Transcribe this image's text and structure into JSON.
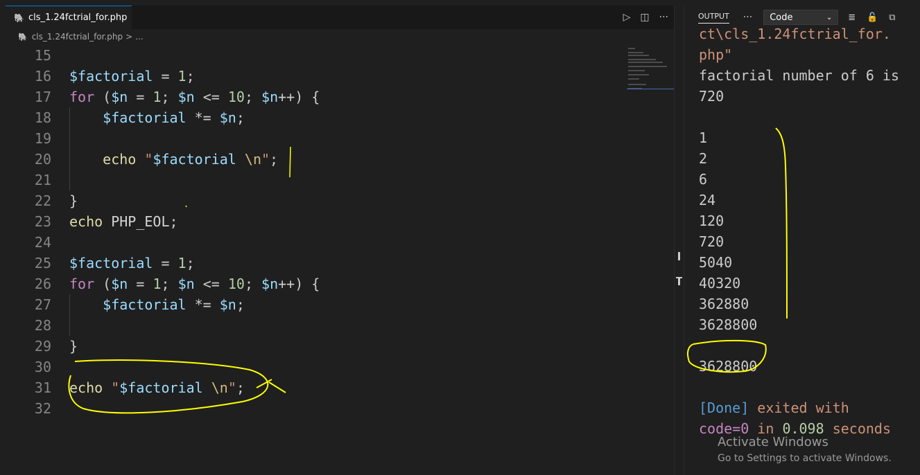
{
  "tab": {
    "filename": "cls_1.24fctrial_for.php",
    "icon": "php-elephant-icon"
  },
  "breadcrumb": {
    "file": "cls_1.24fctrial_for.php",
    "sep": ">",
    "more": "..."
  },
  "editor_actions": {
    "run": "▷",
    "split": "◫",
    "more": "···"
  },
  "code_lines": [
    {
      "num": "15",
      "text": ""
    },
    {
      "num": "16",
      "text": "$factorial = 1;"
    },
    {
      "num": "17",
      "text": "for ($n = 1; $n <= 10; $n++) {"
    },
    {
      "num": "18",
      "text": "    $factorial *= $n;"
    },
    {
      "num": "19",
      "text": ""
    },
    {
      "num": "20",
      "text": "    echo \"$factorial \\n\";"
    },
    {
      "num": "21",
      "text": ""
    },
    {
      "num": "22",
      "text": "}"
    },
    {
      "num": "23",
      "text": "echo PHP_EOL;"
    },
    {
      "num": "24",
      "text": ""
    },
    {
      "num": "25",
      "text": "$factorial = 1;"
    },
    {
      "num": "26",
      "text": "for ($n = 1; $n <= 10; $n++) {"
    },
    {
      "num": "27",
      "text": "    $factorial *= $n;"
    },
    {
      "num": "28",
      "text": ""
    },
    {
      "num": "29",
      "text": "}"
    },
    {
      "num": "30",
      "text": ""
    },
    {
      "num": "31",
      "text": "echo \"$factorial \\n\";"
    },
    {
      "num": "32",
      "text": ""
    }
  ],
  "panel": {
    "title": "OUTPUT",
    "more": "···",
    "channel": "Code"
  },
  "output_lines": [
    "ct\\cls_1.24fctrial_for.",
    "php\"",
    "factorial number of 6 is",
    "720",
    "",
    "1",
    "2",
    "6",
    "24",
    "120",
    "720",
    "5040",
    "40320",
    "362880",
    "3628800",
    "",
    "3628800",
    "",
    "[Done] exited with",
    "code=0 in 0.098 seconds"
  ],
  "watermark": {
    "title": "Activate Windows",
    "subtitle": "Go to Settings to activate Windows."
  },
  "colors": {
    "bg": "#1f1f1f",
    "variable": "#9cdcfe",
    "keyword": "#c586c0",
    "number": "#b5cea8",
    "string": "#ce9178",
    "annotation": "#ffff00",
    "done": "#569cd6"
  }
}
